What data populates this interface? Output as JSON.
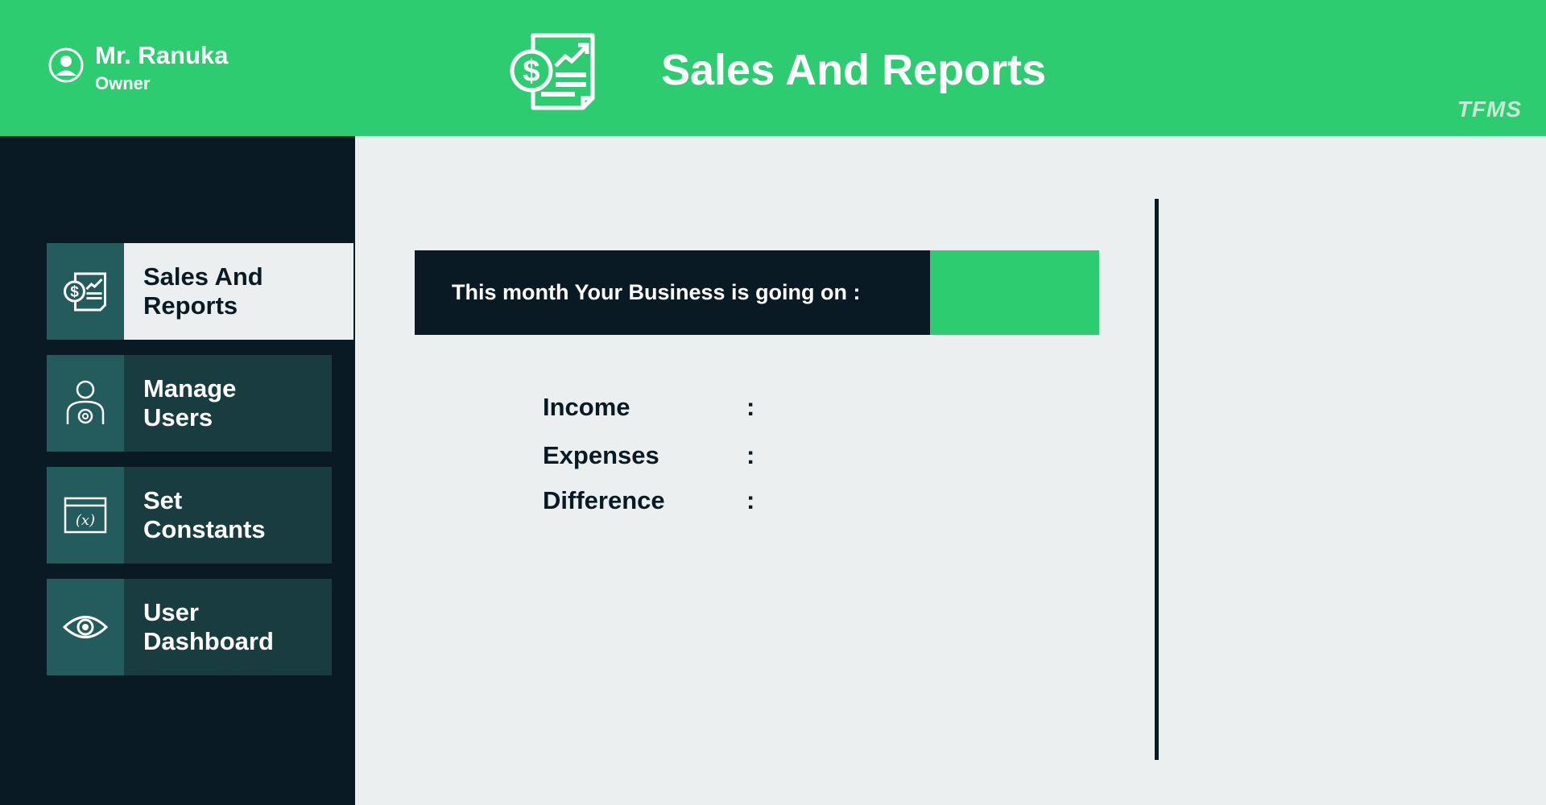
{
  "user": {
    "name": "Mr. Ranuka",
    "role": "Owner",
    "icon": "user-circle-icon"
  },
  "header": {
    "title": "Sales And Reports",
    "icon": "sales-report-icon",
    "brand": "TFMS"
  },
  "colors": {
    "accent": "#2ecc71",
    "dark": "#0a1a24",
    "tile": "#245c5e",
    "panel": "#183c40",
    "background": "#ebeff0"
  },
  "sidebar": {
    "items": [
      {
        "label": "Sales And Reports",
        "icon": "sales-report-icon",
        "active": true
      },
      {
        "label": "Manage Users",
        "icon": "user-gear-icon",
        "active": false
      },
      {
        "label": "Set Constants",
        "icon": "variable-window-icon",
        "active": false
      },
      {
        "label": "User Dashboard",
        "icon": "eye-icon",
        "active": false
      }
    ]
  },
  "main": {
    "banner_text": "This month Your Business is going on :",
    "stats": [
      {
        "label": "Income",
        "separator": ":"
      },
      {
        "label": "Expenses",
        "separator": ":"
      },
      {
        "label": "Difference",
        "separator": ":"
      }
    ]
  }
}
